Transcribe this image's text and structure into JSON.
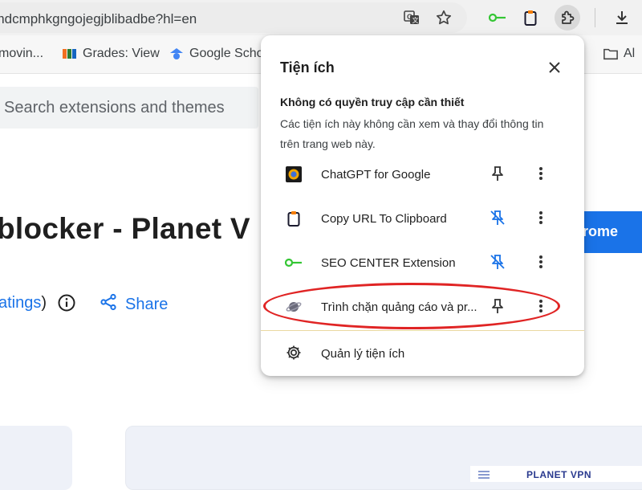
{
  "browser": {
    "url": "amdcmphkgngojegjblibadbe?hl=en",
    "toolbar_icons": [
      "translate-icon",
      "star-icon",
      "seo-key-icon",
      "clipboard-icon",
      "extensions-puzzle-icon",
      "download-icon"
    ]
  },
  "bookmarks": [
    {
      "label": "movin...",
      "icon": "page-icon"
    },
    {
      "label": "Grades: View",
      "icon": "fpt-logo-icon"
    },
    {
      "label": "Google Scho",
      "icon": "scholar-icon"
    },
    {
      "label": "Al",
      "icon": "folder-icon"
    }
  ],
  "page": {
    "search_placeholder": "Search extensions and themes",
    "extension_title": "blocker - Planet V",
    "add_button_label": "rome",
    "ratings_text": "atings",
    "ratings_paren": ")",
    "share_label": "Share",
    "preview_brand": "PLANET VPN"
  },
  "popup": {
    "title": "Tiện ích",
    "section_heading": "Không có quyền truy cập cần thiết",
    "section_description": "Các tiện ích này không cần xem và thay đổi thông tin trên trang web này.",
    "extensions": [
      {
        "name": "ChatGPT for Google",
        "icon": "chatgpt-icon",
        "pinned": true
      },
      {
        "name": "Copy URL To Clipboard",
        "icon": "clipboard-icon",
        "pinned": false
      },
      {
        "name": "SEO CENTER Extension",
        "icon": "seo-key-icon",
        "pinned": false
      },
      {
        "name": "Trình chặn quảng cáo và pr...",
        "icon": "planet-icon",
        "pinned": true
      }
    ],
    "manage_label": "Quản lý tiện ích"
  },
  "colors": {
    "accent": "#1a73e8",
    "highlight": "#e02424",
    "seo_green": "#34c634"
  }
}
